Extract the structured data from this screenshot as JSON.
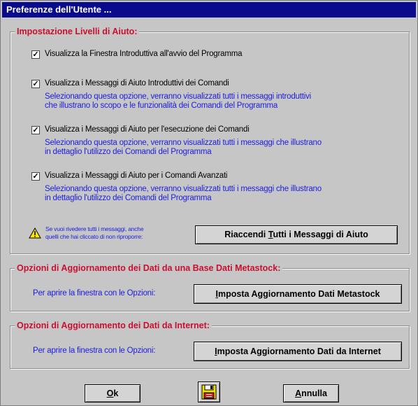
{
  "window": {
    "title": "Preferenze dell'Utente ..."
  },
  "help_group": {
    "legend": "Impostazione Livelli di Aiuto:",
    "items": [
      {
        "label": "Visualizza la Finestra Introduttiva all'avvio del Programma",
        "checked": true,
        "desc": []
      },
      {
        "label": "Visualizza i Messaggi di Aiuto Introduttivi dei Comandi",
        "checked": true,
        "desc": [
          "Selezionando questa opzione, verranno visualizzati tutti i messaggi introduttivi",
          "che illustrano lo scopo e le funzionalità dei Comandi del Programma"
        ]
      },
      {
        "label": "Visualizza i Messaggi di Aiuto per l'esecuzione dei Comandi",
        "checked": true,
        "desc": [
          "Selezionando questa opzione, verranno visualizzati tutti i messaggi che illustrano",
          "in dettaglio l'utilizzo dei Comandi del Programma"
        ]
      },
      {
        "label": "Visualizza i Messaggi di Aiuto per i Comandi Avanzati",
        "checked": true,
        "desc": [
          "Selezionando questa opzione, verranno visualizzati tutti i messaggi che illustrano",
          "in dettaglio l'utilizzo dei Comandi del Programma"
        ]
      }
    ],
    "warning_lines": [
      "Se vuoi rivedere tutti i messaggi, anche",
      "quelli che hai cliccato di non riproporre:"
    ],
    "reset_button": {
      "pre": "Riaccendi ",
      "accel": "T",
      "post": "utti i Messaggi di Aiuto"
    }
  },
  "metastock_group": {
    "legend": "Opzioni di Aggiornamento dei Dati da una Base Dati Metastock:",
    "hint": "Per aprire la finestra con le Opzioni:",
    "button": {
      "accel": "I",
      "post": "mposta Aggiornamento Dati Metastock"
    }
  },
  "internet_group": {
    "legend": "Opzioni di Aggiornamento dei Dati da Internet:",
    "hint": "Per aprire la finestra con le Opzioni:",
    "button": {
      "accel": "I",
      "post": "mposta Aggiornamento Dati da Internet"
    }
  },
  "footer": {
    "ok": {
      "accel": "O",
      "post": "k"
    },
    "cancel": {
      "accel": "A",
      "post": "nnulla"
    },
    "check_mark": "✓"
  },
  "icons": {
    "warning": "warning-icon",
    "save": "floppy-disk-icon"
  }
}
